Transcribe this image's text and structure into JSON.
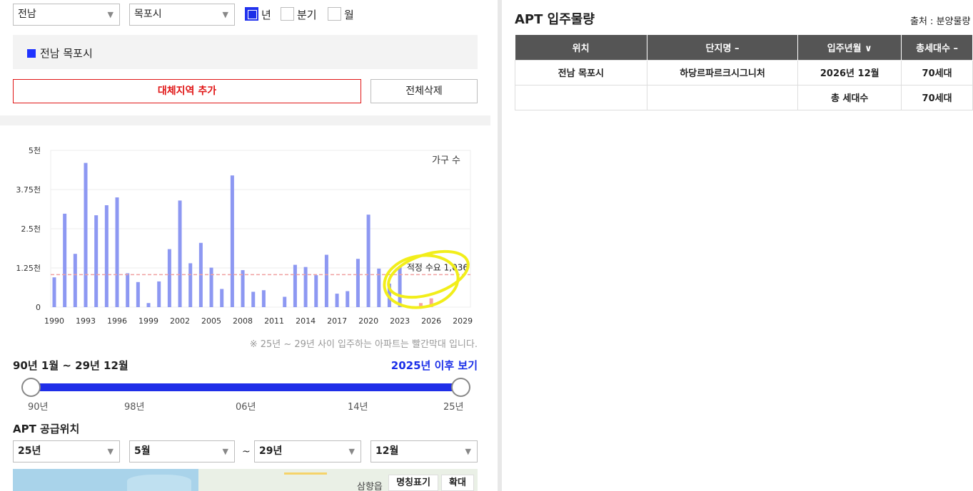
{
  "filters": {
    "province": "전남",
    "city": "목포시",
    "period_options": [
      {
        "label": "년",
        "checked": true
      },
      {
        "label": "분기",
        "checked": false
      },
      {
        "label": "월",
        "checked": false
      }
    ]
  },
  "selected_region": "전남 목포시",
  "buttons": {
    "add_region": "대체지역 추가",
    "delete_all": "전체삭제"
  },
  "chart_data": {
    "type": "bar",
    "legend": "가구 수",
    "y_ticks": [
      "5천",
      "3.75천",
      "2.5천",
      "1.25천",
      "0"
    ],
    "ylim": [
      0,
      5000
    ],
    "x_ticks": [
      "1990",
      "1993",
      "1996",
      "1999",
      "2002",
      "2005",
      "2008",
      "2011",
      "2014",
      "2017",
      "2020",
      "2023",
      "2026",
      "2029"
    ],
    "categories": [
      1990,
      1991,
      1992,
      1993,
      1994,
      1995,
      1996,
      1997,
      1998,
      1999,
      2000,
      2001,
      2002,
      2003,
      2004,
      2005,
      2006,
      2007,
      2008,
      2009,
      2010,
      2011,
      2012,
      2013,
      2014,
      2015,
      2016,
      2017,
      2018,
      2019,
      2020,
      2021,
      2022,
      2023,
      2024,
      2025,
      2026,
      2027,
      2028,
      2029
    ],
    "values": [
      950,
      2980,
      1700,
      4600,
      2930,
      3250,
      3500,
      1080,
      800,
      130,
      820,
      1850,
      3400,
      1400,
      2050,
      1260,
      580,
      4200,
      1180,
      490,
      540,
      0,
      330,
      1350,
      1280,
      1020,
      1670,
      430,
      510,
      1540,
      2950,
      1230,
      750,
      1280,
      0,
      130,
      280,
      0,
      0,
      0
    ],
    "red_from_year": 2025,
    "reference_line": {
      "value": 1036,
      "label": "적정 수요 1,036"
    },
    "colors": {
      "bar": "#8d98f2",
      "future_bar": "#f7a3a3",
      "reference": "#f0a0a0"
    }
  },
  "note": "※ 25년 ~ 29년 사이 입주하는 아파트는 빨간막대 입니다.",
  "range": {
    "title": "90년 1월 ~ 29년 12월",
    "link": "2025년 이후 보기",
    "ticks": [
      "90년",
      "98년",
      "06년",
      "14년",
      "25년"
    ]
  },
  "supply_location": {
    "title": "APT 공급위치",
    "from_year": "25년",
    "from_month": "5월",
    "to_year": "29년",
    "to_month": "12월",
    "separator": "~"
  },
  "map": {
    "place_label": "삼향읍",
    "toggle_label": "명칭표기",
    "zoom_label": "확대"
  },
  "table": {
    "title": "APT 입주물량",
    "source": "출처 : 분양물량",
    "headers": [
      "위치",
      "단지명 –",
      "입주년월 ∨",
      "총세대수 –"
    ],
    "rows": [
      [
        "전남 목포시",
        "하당르파르크시그니처",
        "2026년 12월",
        "70세대"
      ],
      [
        "",
        "",
        "총 세대수",
        "70세대"
      ]
    ]
  }
}
